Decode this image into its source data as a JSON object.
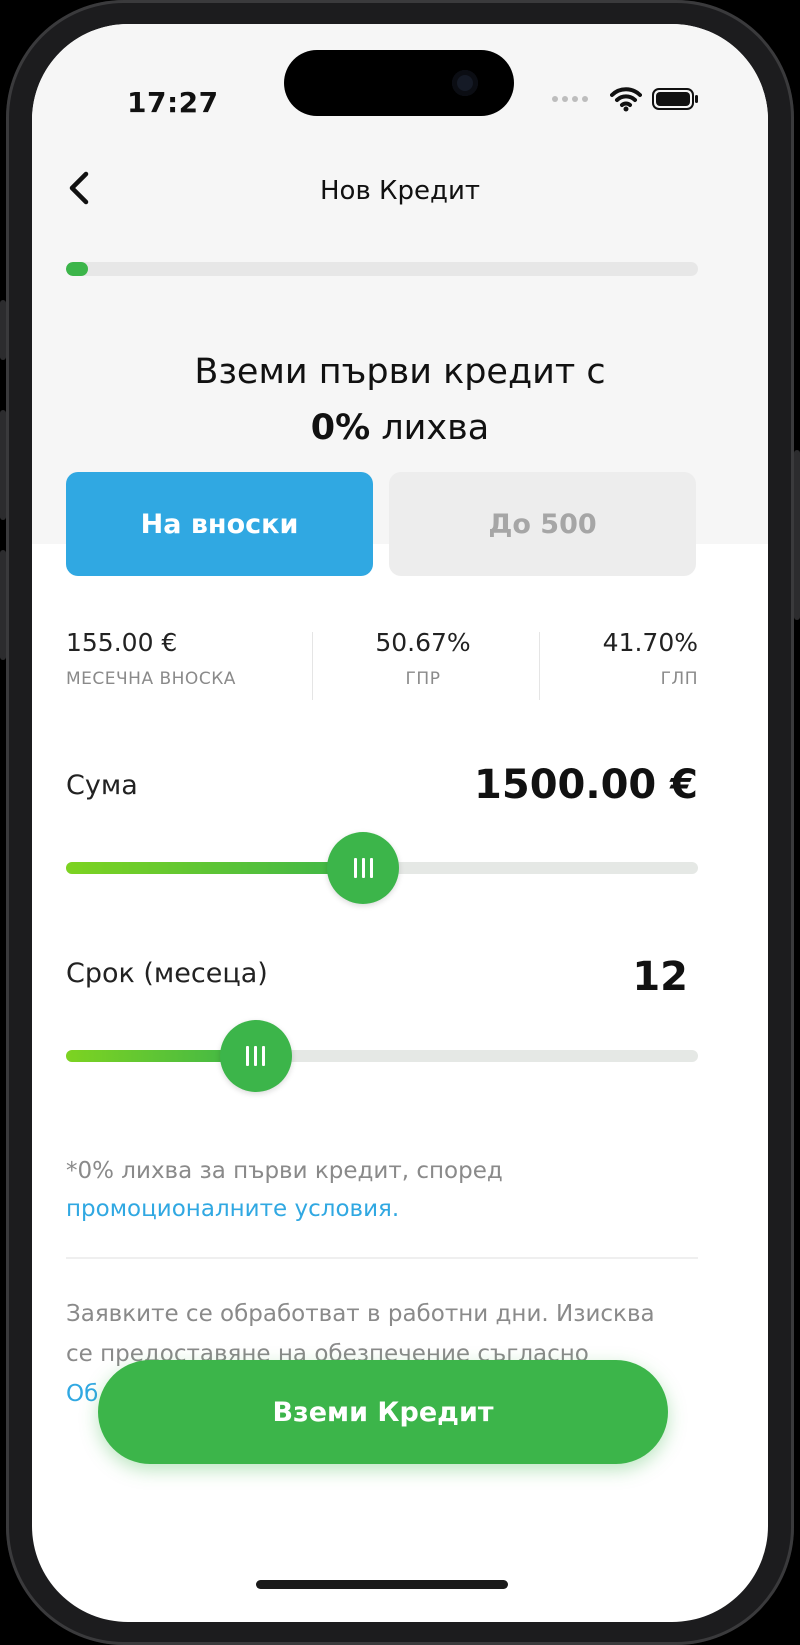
{
  "status_bar": {
    "time": "17:27"
  },
  "nav": {
    "title": "Нов Кредит"
  },
  "progress": {
    "fraction": 0.035
  },
  "headline": {
    "line1": "Вземи първи кредит с",
    "bold_part": "0%",
    "line2_rest": " лихва"
  },
  "tabs": [
    {
      "label": "На вноски",
      "active": true
    },
    {
      "label": "До 500",
      "active": false
    }
  ],
  "stats": [
    {
      "value": "155.00 €",
      "label": "МЕСЕЧНА ВНОСКА"
    },
    {
      "value": "50.67%",
      "label": "ГПР"
    },
    {
      "value": "41.70%",
      "label": "ГЛП"
    }
  ],
  "amount": {
    "label": "Сума",
    "value": "1500.00 €",
    "level": 0.47
  },
  "term": {
    "label": "Срок (месеца)",
    "value": "12",
    "level": 0.3
  },
  "note": {
    "text": "*0% лихва за първи кредит, според ",
    "link": "промоционалните условия."
  },
  "info": {
    "line1": "Заявките се обработват в работни дни. Изисква",
    "line2": "се предоставяне на обезпечение съгласно",
    "line3_partial": "Об"
  },
  "cta": {
    "label": "Вземи Кредит"
  },
  "colors": {
    "brand_green": "#3cb54a",
    "accent_blue": "#30a8e2",
    "gradient_start": "#7dd321"
  }
}
